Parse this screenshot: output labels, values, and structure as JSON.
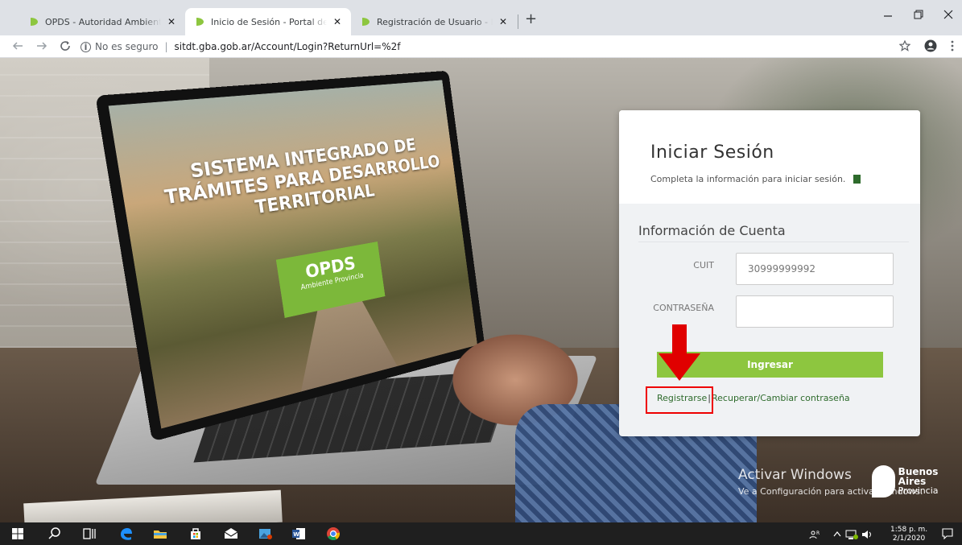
{
  "browser": {
    "tabs": [
      {
        "title": "OPDS - Autoridad Ambiental |",
        "active": false
      },
      {
        "title": "Inicio de Sesión - Portal de Trámites",
        "active": true
      },
      {
        "title": "Registración de Usuario - Portal de",
        "active": false
      }
    ],
    "tab_close": "✕",
    "new_tab": "+",
    "omnibox": {
      "security_label": "No es seguro",
      "url": "sitdt.gba.gob.ar/Account/Login?ReturnUrl=%2f"
    },
    "icons": {
      "back": "back-arrow-icon",
      "forward": "forward-arrow-icon",
      "reload": "reload-icon",
      "star": "bookmark-star-icon",
      "profile": "profile-icon",
      "menu": "kebab-menu-icon"
    }
  },
  "background_screen": {
    "headline": "SISTEMA INTEGRADO DE TRÁMITES PARA DESARROLLO TERRITORIAL",
    "badge_big": "OPDS",
    "badge_small": "Ambiente Provincia"
  },
  "login": {
    "title": "Iniciar Sesión",
    "subtitle": "Completa la información para iniciar sesión.",
    "section_title": "Información de Cuenta",
    "cuit_label": "CUIT",
    "cuit_value": "30999999992",
    "password_label": "CONTRASEÑA",
    "password_value": "",
    "submit_label": "Ingresar",
    "register_link": "Registrarse",
    "link_separator": "|",
    "recover_link": "Recuperar/Cambiar contraseña"
  },
  "watermark": {
    "line1": "Activar Windows",
    "line2": "Ve a Configuración para activar Windows."
  },
  "brand": {
    "line1": "Buenos Aires",
    "line2": "Provincia"
  },
  "taskbar": {
    "time": "1:58 p. m.",
    "date": "2/1/2020"
  },
  "colors": {
    "accent_green": "#8dc63f",
    "link_green": "#2e6b2c",
    "annotation_red": "#e00000"
  }
}
